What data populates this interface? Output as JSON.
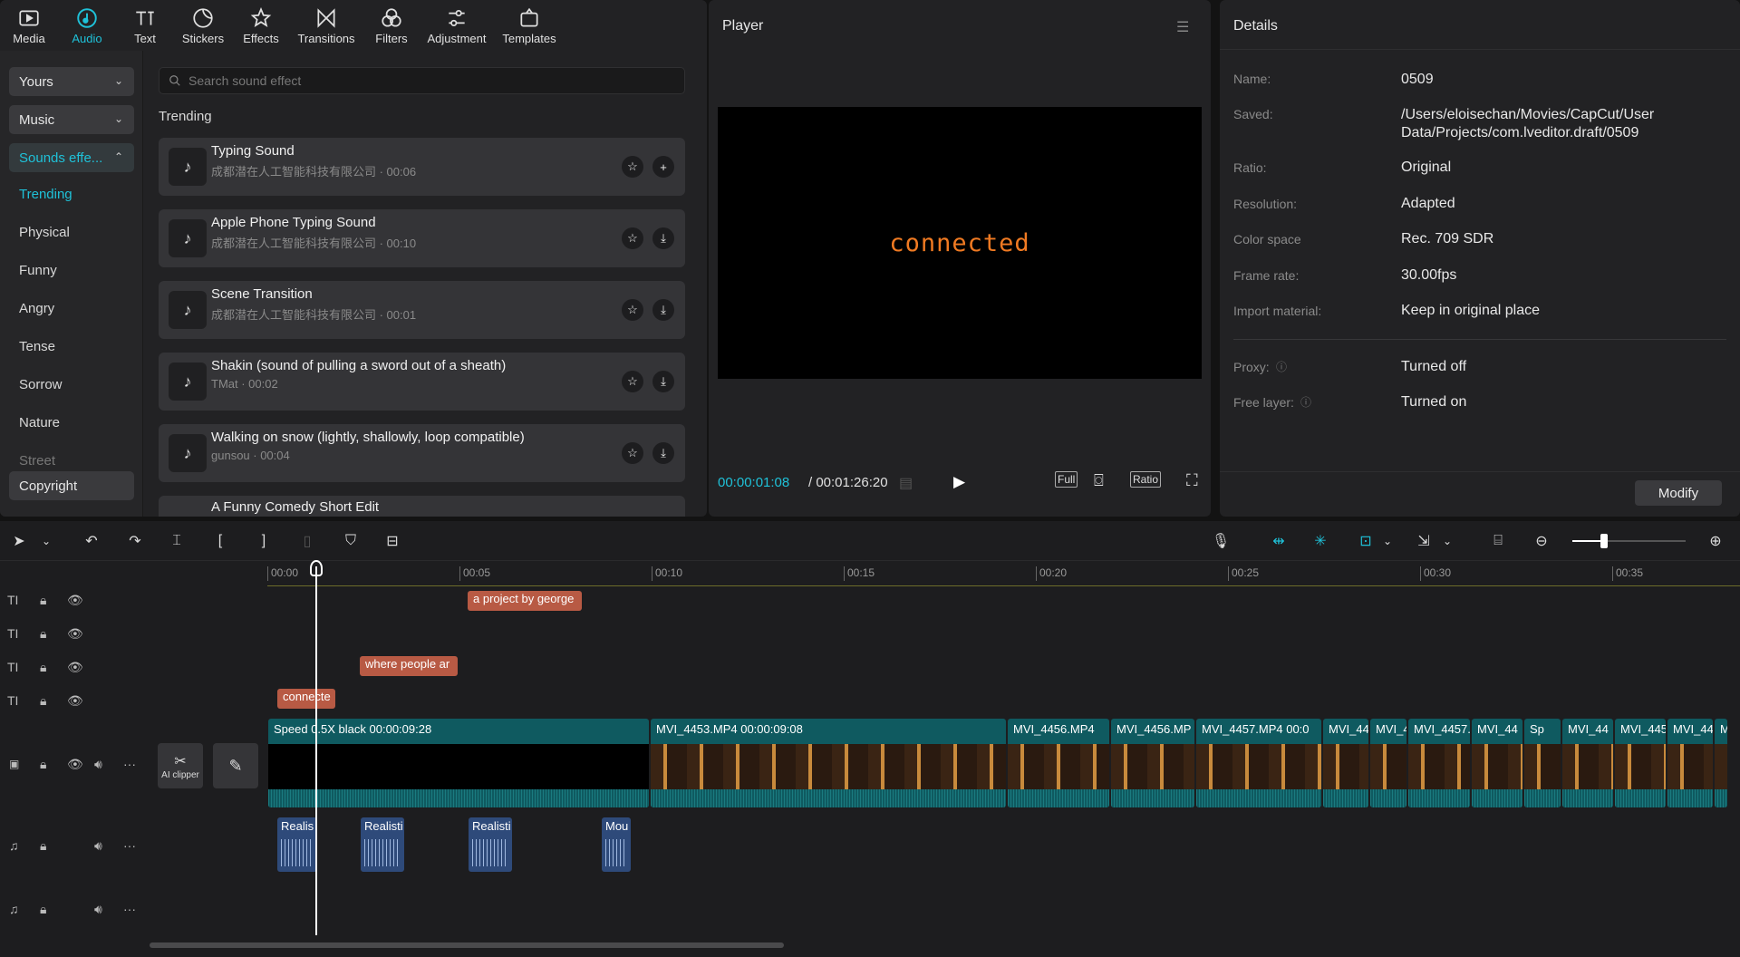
{
  "toolbar": [
    {
      "label": "Media",
      "icon": "media-icon"
    },
    {
      "label": "Audio",
      "icon": "audio-icon",
      "active": true
    },
    {
      "label": "Text",
      "icon": "text-icon"
    },
    {
      "label": "Stickers",
      "icon": "stickers-icon"
    },
    {
      "label": "Effects",
      "icon": "effects-icon"
    },
    {
      "label": "Transitions",
      "icon": "transitions-icon"
    },
    {
      "label": "Filters",
      "icon": "filters-icon"
    },
    {
      "label": "Adjustment",
      "icon": "adjustment-icon"
    },
    {
      "label": "Templates",
      "icon": "templates-icon"
    }
  ],
  "sidebar": {
    "yours": "Yours",
    "music": "Music",
    "sounds": "Sounds effe...",
    "categories": [
      "Trending",
      "Physical",
      "Funny",
      "Angry",
      "Tense",
      "Sorrow",
      "Nature",
      "Street"
    ],
    "copyright": "Copyright"
  },
  "search": {
    "placeholder": "Search sound effect"
  },
  "section_title": "Trending",
  "sounds": [
    {
      "title": "Typing Sound",
      "sub": "成都潜在人工智能科技有限公司 · 00:06",
      "action": "+"
    },
    {
      "title": "Apple Phone Typing Sound",
      "sub": "成都潜在人工智能科技有限公司 · 00:10",
      "action": "⤓"
    },
    {
      "title": "Scene Transition",
      "sub": "成都潜在人工智能科技有限公司 · 00:01",
      "action": "⤓"
    },
    {
      "title": "Shakin (sound of pulling a sword out of a sheath)",
      "sub": "TMat · 00:02",
      "action": "⤓"
    },
    {
      "title": "Walking on snow (lightly, shallowly, loop compatible)",
      "sub": "gunsou · 00:04",
      "action": "⤓"
    },
    {
      "title": "A Funny Comedy Short Edit",
      "sub": "",
      "action": ""
    }
  ],
  "player": {
    "title": "Player",
    "screen_text": "connected",
    "time_current": "00:00:01:08",
    "time_total": "/ 00:01:26:20",
    "full": "Full",
    "ratio": "Ratio"
  },
  "details": {
    "title": "Details",
    "rows": [
      {
        "label": "Name:",
        "value": "0509"
      },
      {
        "label": "Saved:",
        "value": "/Users/eloisechan/Movies/CapCut/User Data/Projects/com.lveditor.draft/0509"
      },
      {
        "label": "Ratio:",
        "value": "Original"
      },
      {
        "label": "Resolution:",
        "value": "Adapted"
      },
      {
        "label": "Color space",
        "value": "Rec. 709 SDR"
      },
      {
        "label": "Frame rate:",
        "value": "30.00fps"
      },
      {
        "label": "Import material:",
        "value": "Keep in original place"
      },
      {
        "label": "Proxy:",
        "value": "Turned off"
      },
      {
        "label": "Free layer:",
        "value": "Turned on"
      }
    ],
    "modify": "Modify"
  },
  "ruler": [
    "00:00",
    "00:05",
    "00:10",
    "00:15",
    "00:20",
    "00:25",
    "00:30",
    "00:35"
  ],
  "text_clips": [
    "a project by george",
    "where people ar",
    "connecte"
  ],
  "video_clips": [
    {
      "label": "Speed 0.5X   black   00:00:09:28"
    },
    {
      "label": "MVI_4453.MP4   00:00:09:08"
    },
    {
      "label": "MVI_4456.MP4"
    },
    {
      "label": "MVI_4456.MP"
    },
    {
      "label": "MVI_4457.MP4   00:0"
    },
    {
      "label": "MVI_44"
    },
    {
      "label": "MVI_4"
    },
    {
      "label": "MVI_4457."
    },
    {
      "label": "MVI_44"
    },
    {
      "label": "Sp"
    },
    {
      "label": "MVI_44"
    },
    {
      "label": "MVI_445"
    },
    {
      "label": "MVI_44"
    },
    {
      "label": "M"
    }
  ],
  "audio_clips": [
    "Realis",
    "Realisti",
    "Realisti",
    "Mou"
  ],
  "ai_clipper": "AI clipper"
}
